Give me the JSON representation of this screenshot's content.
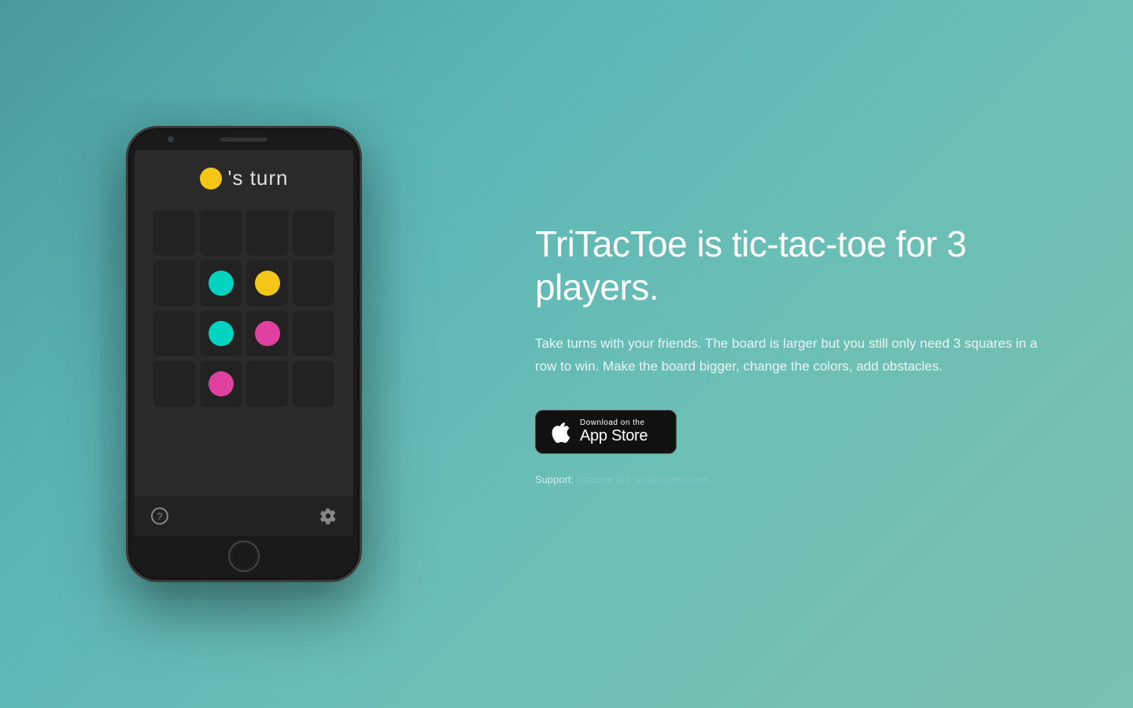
{
  "background": {
    "gradient_start": "#4a9a9a",
    "gradient_end": "#7abfb0"
  },
  "phone": {
    "turn_indicator": {
      "dot_color": "#f5c518",
      "text": "'s turn"
    },
    "grid": {
      "rows": 4,
      "cols": 4,
      "cells": [
        {
          "row": 0,
          "col": 0,
          "dot": null
        },
        {
          "row": 0,
          "col": 1,
          "dot": null
        },
        {
          "row": 0,
          "col": 2,
          "dot": null
        },
        {
          "row": 0,
          "col": 3,
          "dot": null
        },
        {
          "row": 1,
          "col": 0,
          "dot": null
        },
        {
          "row": 1,
          "col": 1,
          "dot": "cyan"
        },
        {
          "row": 1,
          "col": 2,
          "dot": "yellow"
        },
        {
          "row": 1,
          "col": 3,
          "dot": null
        },
        {
          "row": 2,
          "col": 0,
          "dot": null
        },
        {
          "row": 2,
          "col": 1,
          "dot": "cyan"
        },
        {
          "row": 2,
          "col": 2,
          "dot": "pink"
        },
        {
          "row": 2,
          "col": 3,
          "dot": null
        },
        {
          "row": 3,
          "col": 0,
          "dot": null
        },
        {
          "row": 3,
          "col": 1,
          "dot": "pink"
        },
        {
          "row": 3,
          "col": 2,
          "dot": null
        },
        {
          "row": 3,
          "col": 3,
          "dot": null
        }
      ]
    },
    "bottom_bar": {
      "help_icon": "?",
      "settings_icon": "gear"
    }
  },
  "content": {
    "headline": "TriTacToe is tic-tac-toe for 3 players.",
    "description": "Take turns with your friends. The board is larger but you still only need 3 squares in a row to win. Make the board bigger, change the colors, add obstacles.",
    "app_store_button": {
      "download_on": "Download on the",
      "store_name": "App Store"
    },
    "support_label": "Support:",
    "support_email": "tritactoe [at] sunshocked.com"
  }
}
